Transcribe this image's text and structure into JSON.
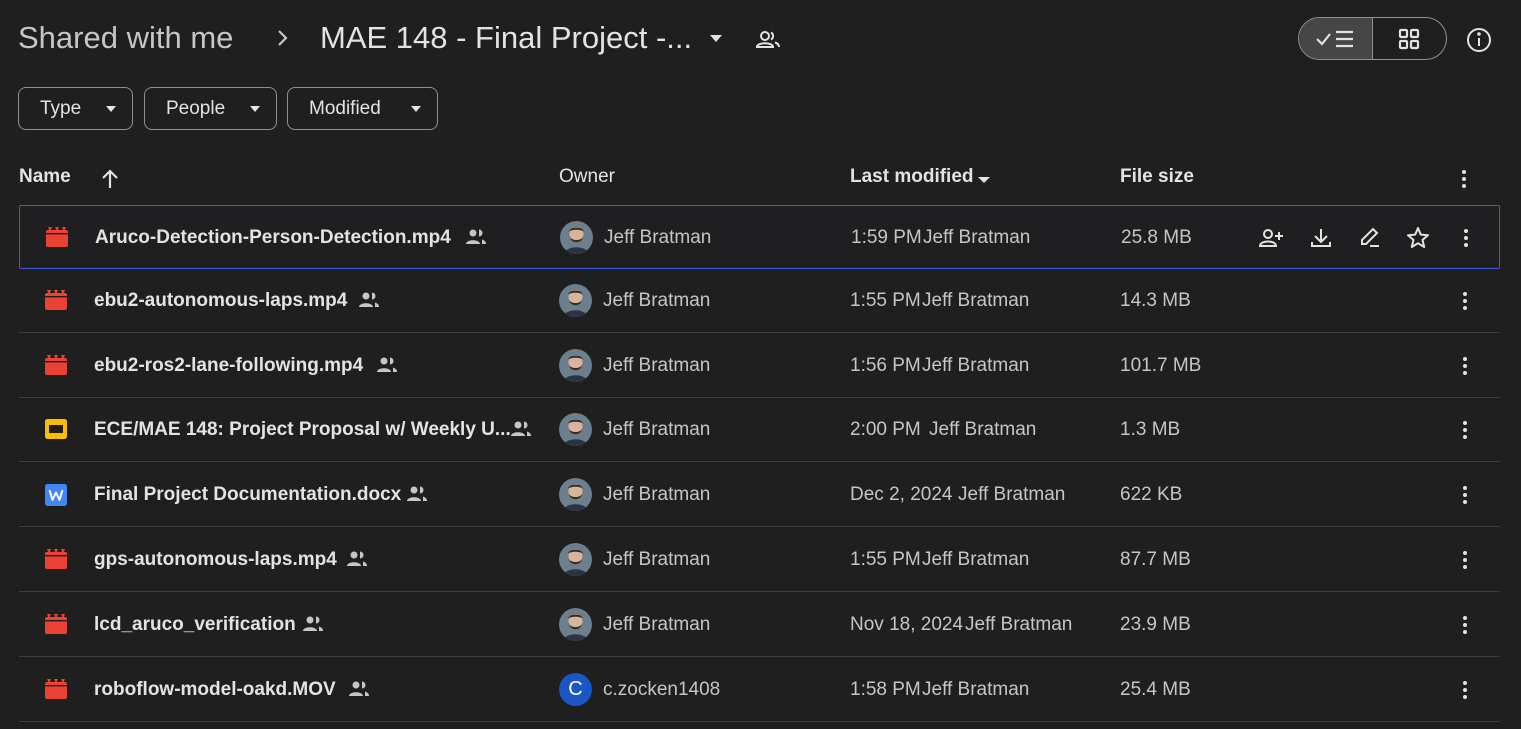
{
  "breadcrumb": {
    "root": "Shared with me",
    "current": "MAE 148 - Final Project -..."
  },
  "icons": {
    "breadcrumb_separator": "chevron-right-icon",
    "folder_menu": "arrow-drop-down-icon",
    "folder_shared": "people-icon",
    "list_view": "check-list-icon",
    "grid_view": "grid-icon",
    "details": "info-icon",
    "video_file": "video-file-icon",
    "slides_file": "slides-file-icon",
    "word_file": "word-file-icon"
  },
  "filters": {
    "type": "Type",
    "people": "People",
    "modified": "Modified"
  },
  "columns": {
    "name": "Name",
    "owner": "Owner",
    "last_modified": "Last modified",
    "file_size": "File size"
  },
  "colors": {
    "background": "#1f1f1f",
    "video_icon": "#ea4335",
    "slides_icon": "#fbbc04",
    "word_icon": "#4285f4",
    "selected_border": "#3b5bdb",
    "avatar_c": "#1a56c4"
  },
  "row_actions": [
    "share-icon",
    "download-icon",
    "rename-icon",
    "star-icon"
  ],
  "files": [
    {
      "name": "Aruco-Detection-Person-Detection.mp4",
      "type": "video",
      "owner": "Jeff Bratman",
      "modified": "1:59 PM",
      "modified_by": "Jeff Bratman",
      "size": "25.8 MB",
      "selected": true
    },
    {
      "name": "ebu2-autonomous-laps.mp4",
      "type": "video",
      "owner": "Jeff Bratman",
      "modified": "1:55 PM",
      "modified_by": "Jeff Bratman",
      "size": "14.3 MB"
    },
    {
      "name": "ebu2-ros2-lane-following.mp4",
      "type": "video",
      "owner": "Jeff Bratman",
      "modified": "1:56 PM",
      "modified_by": "Jeff Bratman",
      "size": "101.7 MB"
    },
    {
      "name": "ECE/MAE 148: Project Proposal w/ Weekly U...",
      "type": "slides",
      "owner": "Jeff Bratman",
      "modified": "2:00 PM",
      "modified_by": "Jeff Bratman",
      "size": "1.3 MB"
    },
    {
      "name": "Final Project Documentation.docx",
      "type": "word",
      "owner": "Jeff Bratman",
      "modified": "Dec 2, 2024",
      "modified_by": "Jeff Bratman",
      "size": "622 KB"
    },
    {
      "name": "gps-autonomous-laps.mp4",
      "type": "video",
      "owner": "Jeff Bratman",
      "modified": "1:55 PM",
      "modified_by": "Jeff Bratman",
      "size": "87.7 MB"
    },
    {
      "name": "lcd_aruco_verification",
      "type": "video",
      "owner": "Jeff Bratman",
      "modified": "Nov 18, 2024",
      "modified_by": "Jeff Bratman",
      "size": "23.9 MB"
    },
    {
      "name": "roboflow-model-oakd.MOV",
      "type": "video",
      "owner": "c.zocken1408",
      "owner_initial": "C",
      "modified": "1:58 PM",
      "modified_by": "Jeff Bratman",
      "size": "25.4 MB"
    }
  ]
}
